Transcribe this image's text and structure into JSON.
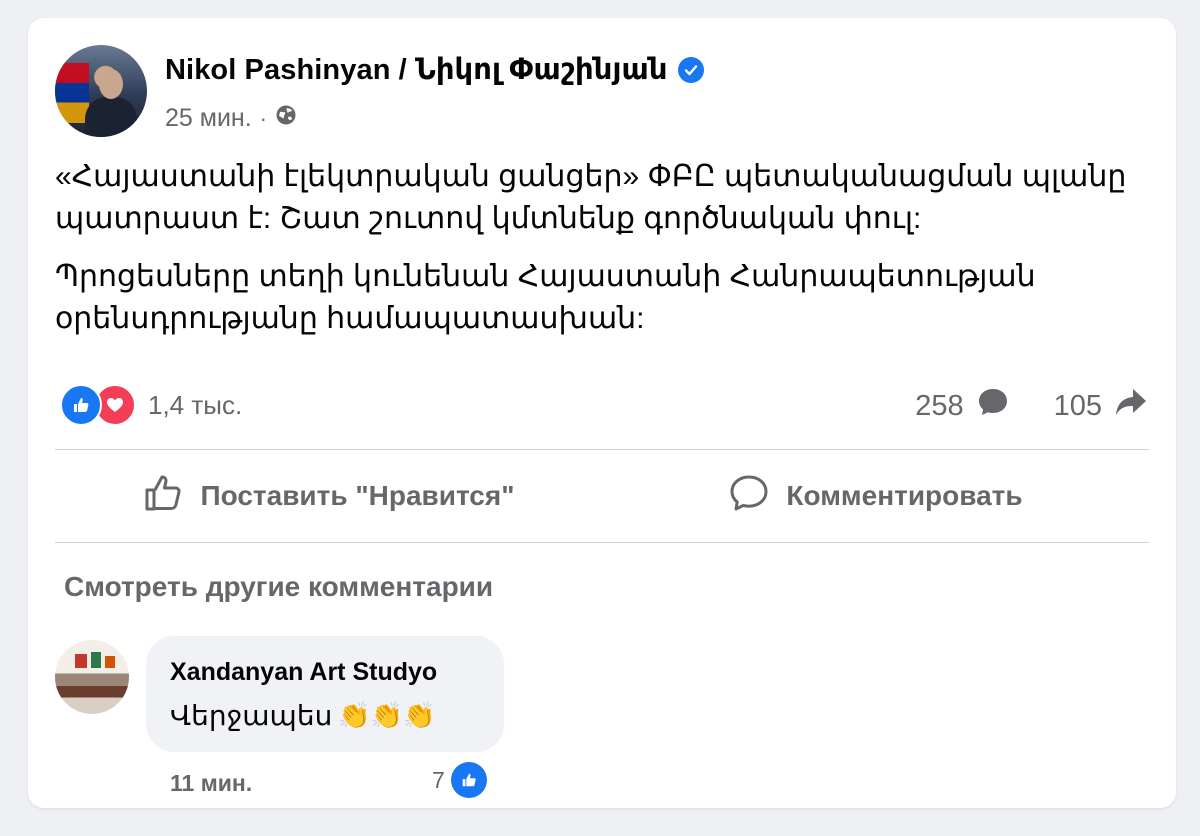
{
  "post": {
    "author": "Nikol Pashinyan / Նիկոլ Փաշինյան",
    "verified": true,
    "time": "25 мин.",
    "privacy_icon": "globe-icon",
    "paragraphs": [
      "«Հայաստանի էլեկտրական ցանցեր» ՓԲԸ պետականացման պլանը պատրաստ է: Շատ շուտով կմտնենք գործնական փուլ:",
      "Պրոցեսները տեղի կունենան Հայաստանի Հանրապետության օրենսդրությանը համապատասխան:"
    ],
    "reactions_count": "1,4 тыс.",
    "comments_count": "258",
    "shares_count": "105"
  },
  "actions": {
    "like_label": "Поставить \"Нравится\"",
    "comment_label": "Комментировать"
  },
  "comments": {
    "more_label": "Смотреть другие комментарии",
    "items": [
      {
        "author": "Xandanyan Art Studyo",
        "text": "Վերջապես",
        "emoji": "👏👏👏",
        "time": "11 мин.",
        "likes": "7"
      }
    ]
  },
  "colors": {
    "accent": "#1877f2",
    "love": "#f33e58",
    "secondary_text": "#65676b",
    "background": "#eef0f3"
  }
}
